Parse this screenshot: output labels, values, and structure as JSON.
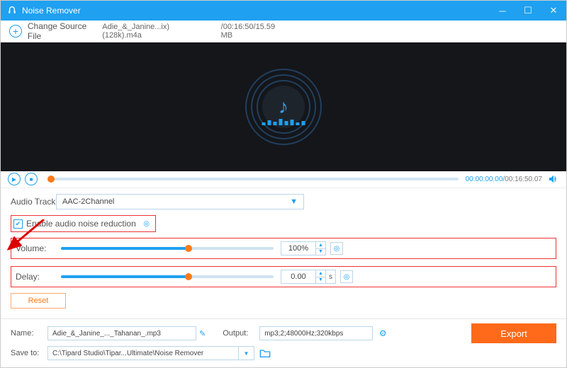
{
  "title": "Noise Remover",
  "source": {
    "change_label": "Change Source File",
    "filename": "Adie_&_Janine...ix)(128k).m4a",
    "info": "/00:16:50/15.59 MB"
  },
  "player": {
    "time_now": "00:00:00.00",
    "time_total": "/00:16:50.07"
  },
  "audio_track": {
    "label": "Audio Track",
    "value": "AAC-2Channel"
  },
  "enable_noise": "Enable audio noise reduction",
  "volume": {
    "label": "Volume:",
    "value": "100%",
    "pct": 60
  },
  "delay": {
    "label": "Delay:",
    "value": "0.00",
    "unit": "s",
    "pct": 60
  },
  "reset": "Reset",
  "name": {
    "label": "Name:",
    "value": "Adie_&_Janine_..._Tahanan_.mp3"
  },
  "output": {
    "label": "Output:",
    "value": "mp3;2;48000Hz;320kbps"
  },
  "saveto": {
    "label": "Save to:",
    "value": "C:\\Tipard Studio\\Tipar...Ultimate\\Noise Remover"
  },
  "export": "Export"
}
